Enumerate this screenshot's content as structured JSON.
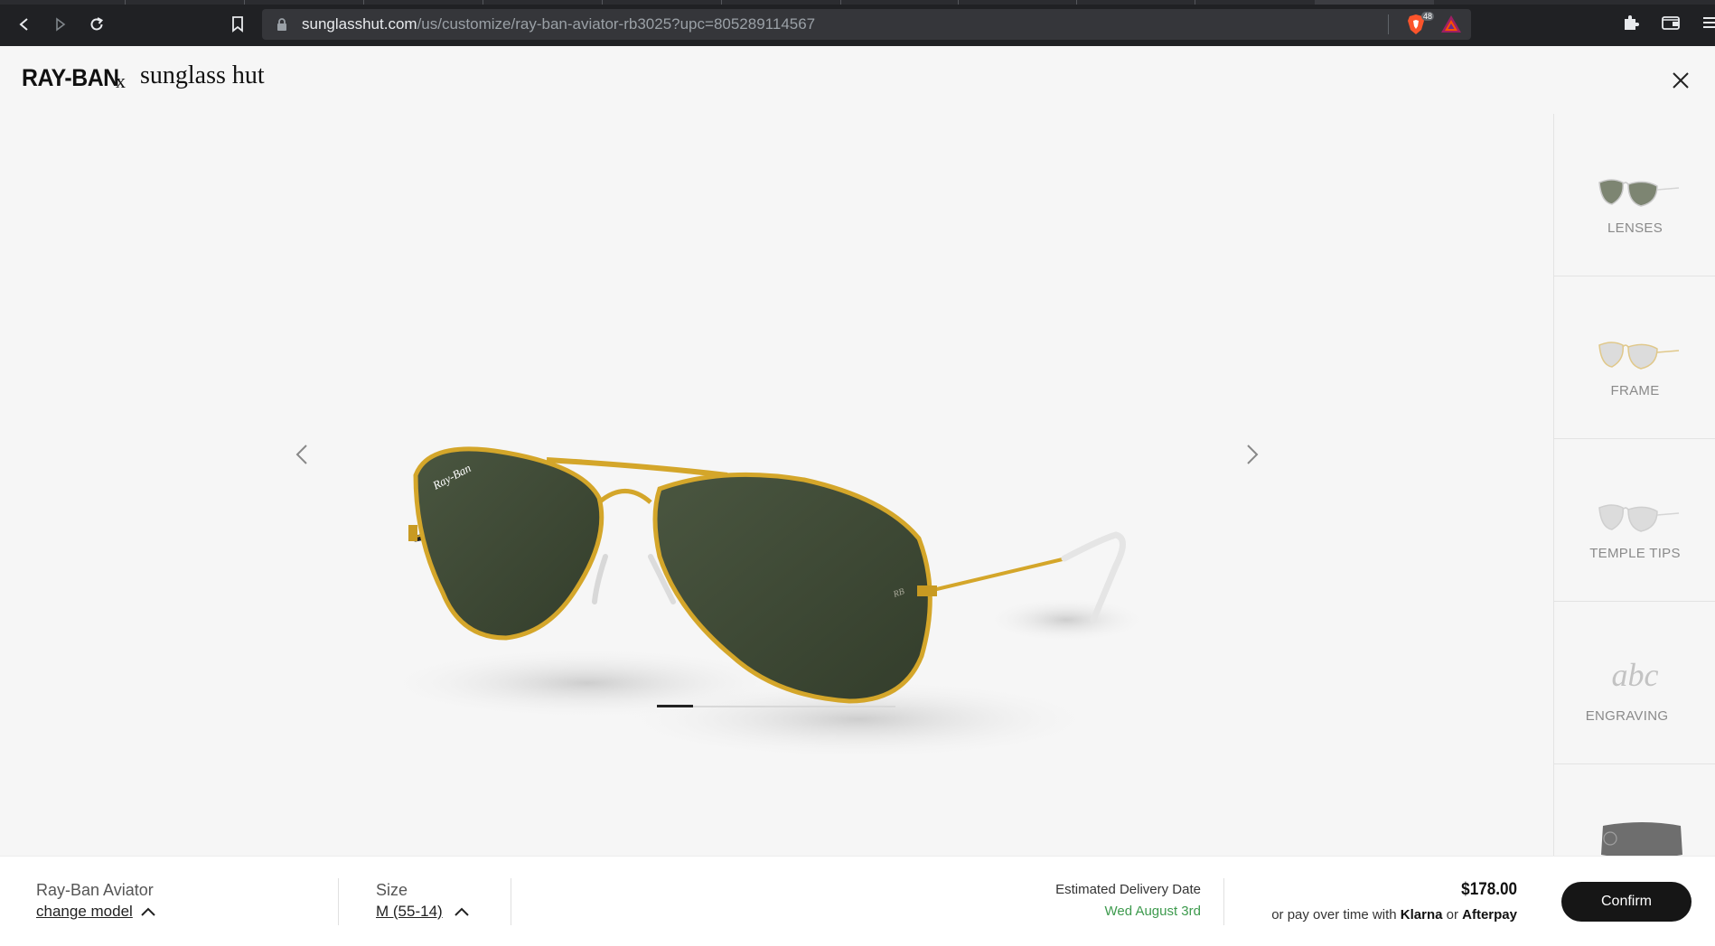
{
  "browser": {
    "url_host": "sunglasshut.com",
    "url_path": "/us/customize/ray-ban-aviator-rb3025?upc=805289114567",
    "shield_count": "48",
    "icons": [
      "back-icon",
      "forward-icon",
      "reload-icon",
      "bookmark-icon",
      "lock-icon",
      "brave-shield-icon",
      "bat-rewards-icon",
      "extensions-icon",
      "wallet-icon",
      "menu-icon"
    ]
  },
  "header": {
    "brand_left": "RAY-BAN",
    "brand_x": "x",
    "brand_right": "sunglass hut",
    "close_icon": "close-icon"
  },
  "viewer": {
    "image_alt": "Ray-Ban Aviator gold frame green lenses",
    "slides_total": 6,
    "slide_current": 1
  },
  "rail": {
    "items": [
      {
        "label": "LENSES",
        "icon": "lenses-thumbnail"
      },
      {
        "label": "FRAME",
        "icon": "frame-thumbnail"
      },
      {
        "label": "TEMPLE TIPS",
        "icon": "temple-tips-thumbnail"
      },
      {
        "label": "ENGRAVING",
        "glyph": "abc"
      },
      {
        "label": "",
        "icon": "case-thumbnail"
      }
    ]
  },
  "footer": {
    "model_name": "Ray-Ban Aviator",
    "change_model": "change model",
    "size_label": "Size",
    "size_value": "M (55-14)",
    "delivery_label": "Estimated Delivery Date",
    "delivery_date": "Wed August 3rd",
    "price": "$178.00",
    "pay_prefix": "or pay over time with",
    "pay_klarna": "Klarna",
    "pay_or": "or",
    "pay_afterpay": "Afterpay",
    "confirm": "Confirm"
  },
  "colors": {
    "browser_bg": "#202124",
    "page_bg": "#f6f6f6",
    "confirm_bg": "#161616",
    "delivery_green": "#3d9a4d",
    "frame_gold": "#d4a62a",
    "lens_green": "#3b4631"
  }
}
